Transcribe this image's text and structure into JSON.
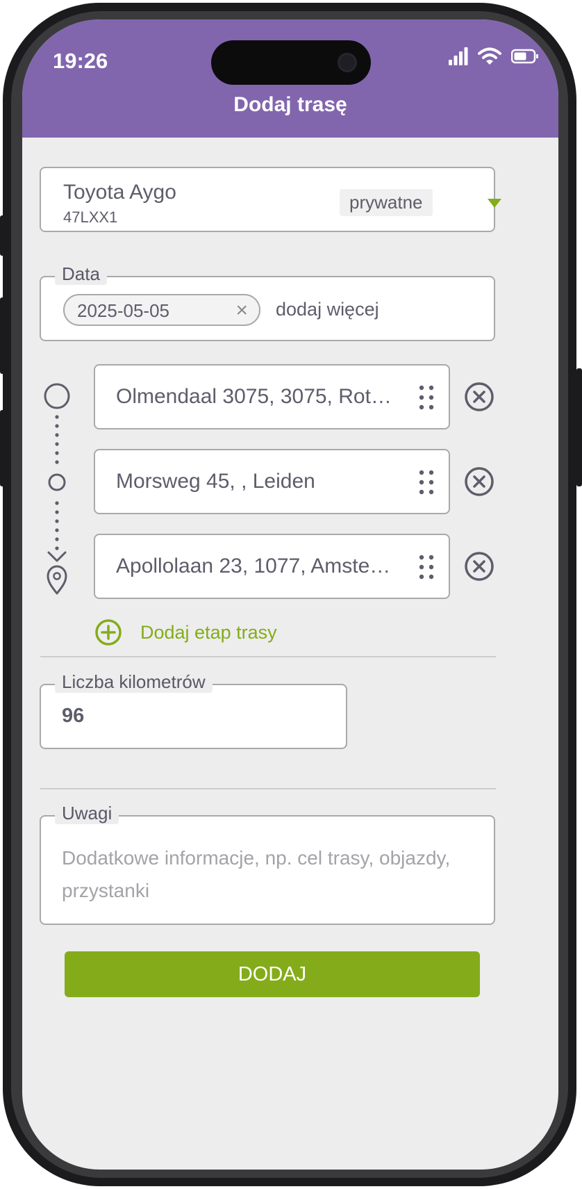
{
  "status_bar": {
    "time": "19:26"
  },
  "header": {
    "title": "Dodaj trasę"
  },
  "vehicle": {
    "name": "Toyota Aygo",
    "plate": "47LXX1",
    "type": "prywatne"
  },
  "date_field": {
    "label": "Data",
    "chip": "2025-05-05",
    "add_more": "dodaj więcej"
  },
  "route": {
    "stops": [
      {
        "address": "Olmendaal 3075, 3075, Rott…"
      },
      {
        "address": "Morsweg 45, , Leiden"
      },
      {
        "address": "Apollolaan 23, 1077, Amster…"
      }
    ],
    "add_stop_label": "Dodaj etap trasy"
  },
  "km_field": {
    "label": "Liczba kilometrów",
    "value": "96"
  },
  "notes_field": {
    "label": "Uwagi",
    "placeholder": "Dodatkowe informacje, np. cel trasy, objazdy, przystanki"
  },
  "submit_button": {
    "label": "DODAJ"
  },
  "colors": {
    "header": "#8166ae",
    "accent": "#84ac1a",
    "text": "#5d5d6b",
    "background": "#ededed"
  }
}
